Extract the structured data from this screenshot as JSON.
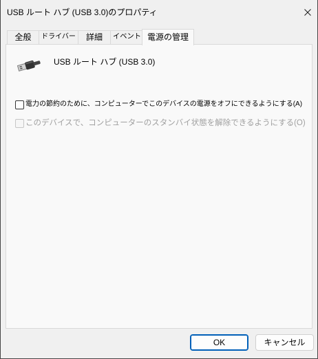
{
  "window": {
    "title": "USB ルート ハブ (USB 3.0)のプロパティ",
    "close_icon": "close-icon"
  },
  "tabs": [
    {
      "label": "全般",
      "selected": false
    },
    {
      "label": "ドライバー",
      "selected": false
    },
    {
      "label": "詳細",
      "selected": false
    },
    {
      "label": "イベント",
      "selected": false
    },
    {
      "label": "電源の管理",
      "selected": true
    }
  ],
  "power_management": {
    "device": {
      "icon": "usb-plug-icon",
      "name": "USB ルート ハブ (USB 3.0)"
    },
    "options": [
      {
        "label": "電力の節約のために、コンピューターでこのデバイスの電源をオフにできるようにする(A)",
        "checked": false,
        "enabled": true
      },
      {
        "label": "このデバイスで、コンピューターのスタンバイ状態を解除できるようにする(O)",
        "checked": false,
        "enabled": false
      }
    ]
  },
  "buttons": {
    "ok": "OK",
    "cancel": "キャンセル"
  },
  "colors": {
    "dialog_background": "#f0f0f0",
    "panel_background": "#f9f9f9",
    "tab_border": "#d9d9d9",
    "accent": "#005fb8",
    "disabled_text": "#a0a0a0"
  }
}
